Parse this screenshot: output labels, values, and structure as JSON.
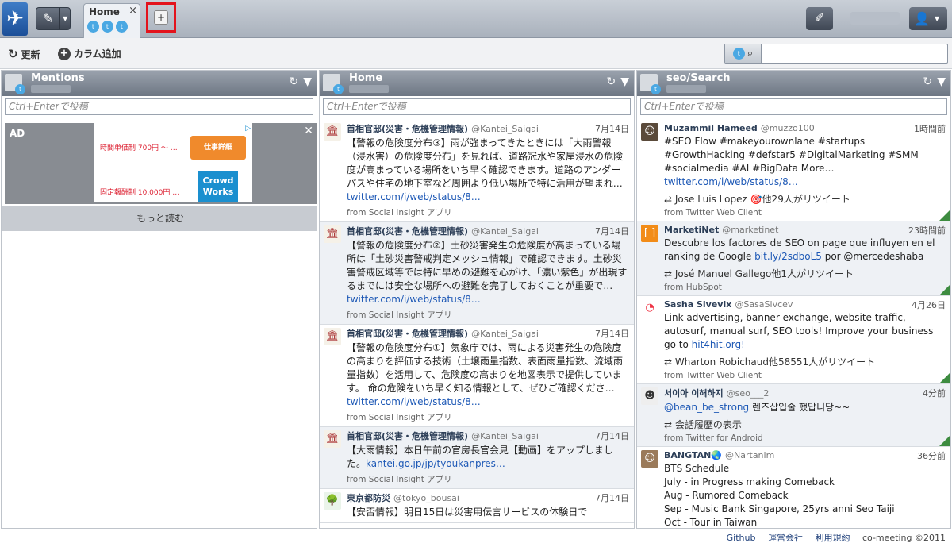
{
  "topbar": {
    "logo_icon": "bird-logo-icon",
    "compose_icon": "compose-icon",
    "tab": {
      "title": "Home",
      "close": "×"
    },
    "add_tab_label": "+"
  },
  "toolbar": {
    "refresh_label": "更新",
    "add_column_label": "カラム追加",
    "search_placeholder": ""
  },
  "columns": [
    {
      "title": "Mentions",
      "post_placeholder": "Ctrl+Enterで投稿",
      "ad": {
        "label": "AD",
        "line1": "時間単価制 700円 〜 …",
        "line2": "固定報酬制 10,000円 …",
        "button1": "仕事詳細",
        "button2a": "Crowd",
        "button2b": "Works"
      },
      "more_label": "もっと読む"
    },
    {
      "title": "Home",
      "post_placeholder": "Ctrl+Enterで投稿",
      "tweets": [
        {
          "name": "首相官邸(災害・危機管理情報)",
          "handle": "@Kantei_Saigai",
          "time": "7月14日",
          "body": "【警報の危険度分布③】雨が強まってきたときには「大雨警報（浸水害）の危険度分布」を見れば、道路冠水や家屋浸水の危険度が高まっている場所をいち早く確認できます。道路のアンダーパスや住宅の地下室など周囲より低い場所で特に活用が望まれ… ",
          "link": "twitter.com/i/web/status/8…",
          "from": "from ",
          "source": "Social Insight アプリ"
        },
        {
          "name": "首相官邸(災害・危機管理情報)",
          "handle": "@Kantei_Saigai",
          "time": "7月14日",
          "body": "【警報の危険度分布②】土砂災害発生の危険度が高まっている場所は「土砂災害警戒判定メッシュ情報」で確認できます。土砂災害警戒区域等では特に早めの避難を心がけ、「濃い紫色」が出現するまでには安全な場所への避難を完了しておくことが重要で… ",
          "link": "twitter.com/i/web/status/8…",
          "from": "from ",
          "source": "Social Insight アプリ"
        },
        {
          "name": "首相官邸(災害・危機管理情報)",
          "handle": "@Kantei_Saigai",
          "time": "7月14日",
          "body": "【警報の危険度分布①】気象庁では、雨による災害発生の危険度の高まりを評価する技術（土壌雨量指数、表面雨量指数、流域雨量指数）を活用して、危険度の高まりを地図表示で提供しています。 命の危険をいち早く知る情報として、ぜひご確認くださ… ",
          "link": "twitter.com/i/web/status/8…",
          "from": "from ",
          "source": "Social Insight アプリ"
        },
        {
          "name": "首相官邸(災害・危機管理情報)",
          "handle": "@Kantei_Saigai",
          "time": "7月14日",
          "body": "【大雨情報】本日午前の官房長官会見【動画】をアップしました。",
          "link": "kantei.go.jp/jp/tyoukanpres…",
          "from": "from ",
          "source": "Social Insight アプリ"
        },
        {
          "name": "東京都防災",
          "handle": "@tokyo_bousai",
          "time": "7月14日",
          "body": "【安否情報】明日15日は災害用伝言サービスの体験日で",
          "link": "",
          "from": "",
          "source": ""
        }
      ]
    },
    {
      "title": "seo/Search",
      "post_placeholder": "Ctrl+Enterで投稿",
      "tweets": [
        {
          "name": "Muzammil Hameed",
          "handle": "@muzzo100",
          "time": "1時間前",
          "body": "#SEO Flow #makeyourownlane #startups #GrowthHacking #defstar5 #DigitalMarketing #SMM #socialmedia #AI #BigData More… ",
          "link": "twitter.com/i/web/status/8…",
          "rt": "Jose Luis Lopez 🎯他29人がリツイート",
          "from": "from ",
          "source": "Twitter Web Client"
        },
        {
          "name": "MarketiNet",
          "handle": "@marketinet",
          "time": "23時間前",
          "body": "Descubre los factores de SEO on page que influyen en el ranking de Google ",
          "link": "bit.ly/2sdboL5",
          "tail": " por @mercedeshaba",
          "rt": "José Manuel Gallego他1人がリツイート",
          "from": "from ",
          "source": "HubSpot"
        },
        {
          "name": "Sasha Sivevix",
          "handle": "@SasaSivcev",
          "time": "4月26日",
          "body": "Link advertising, banner exchange, website traffic, autosurf, manual surf, SEO tools! Improve your business go to ",
          "link": "hit4hit.org!",
          "rt": "Wharton Robichaud他58551人がリツイート",
          "from": "from ",
          "source": "Twitter Web Client"
        },
        {
          "name": "서이아 이해하지",
          "handle": "@seo___2",
          "time": "4分前",
          "body": "",
          "link": "@bean_be_strong",
          "tail": " 렌즈삽입술 했답니당~~",
          "rt": "会話履歴の表示",
          "from": "from ",
          "source": "Twitter for Android"
        },
        {
          "name": "BANGTAN🌏",
          "handle": "@Nartanim",
          "time": "36分前",
          "body": "BTS Schedule\nJuly - in Progress making Comeback\nAug - Rumored Comeback\nSep - Music Bank Singapore, 25yrs anni Seo Taiji\nOct - Tour in Taiwan",
          "link": "",
          "rt": "",
          "from": "",
          "source": ""
        }
      ]
    }
  ],
  "footer": {
    "links": [
      "Github",
      "運営会社",
      "利用規約"
    ],
    "copyright": "co-meeting ©2011"
  },
  "colors": {
    "accent": "#4aa8e3",
    "highlight": "#e3131c",
    "link": "#1e59b6"
  }
}
